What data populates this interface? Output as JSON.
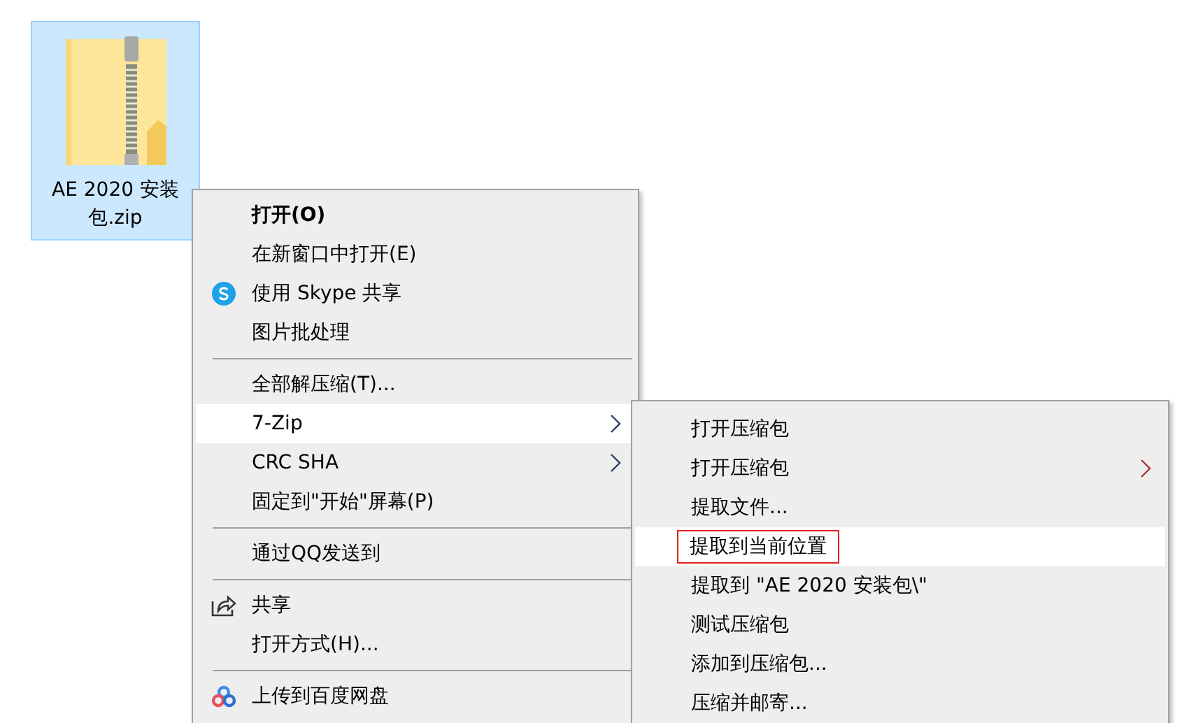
{
  "file": {
    "name": "AE 2020 安装包.zip",
    "selected": true
  },
  "context_menu": {
    "items": [
      {
        "kind": "item",
        "label": "打开(O)",
        "bold": true,
        "has_submenu": false,
        "selected": false
      },
      {
        "kind": "item",
        "label": "在新窗口中打开(E)",
        "bold": false,
        "has_submenu": false,
        "selected": false
      },
      {
        "kind": "skype",
        "label": "使用 Skype 共享",
        "bold": false,
        "has_submenu": false,
        "selected": false
      },
      {
        "kind": "item",
        "label": "图片批处理",
        "bold": false,
        "has_submenu": false,
        "selected": false
      },
      {
        "kind": "separator"
      },
      {
        "kind": "item",
        "label": "全部解压缩(T)...",
        "bold": false,
        "has_submenu": false,
        "selected": false
      },
      {
        "kind": "item",
        "label": "7-Zip",
        "bold": false,
        "has_submenu": true,
        "selected": true
      },
      {
        "kind": "item",
        "label": "CRC SHA",
        "bold": false,
        "has_submenu": true,
        "selected": false
      },
      {
        "kind": "item",
        "label": "固定到\"开始\"屏幕(P)",
        "bold": false,
        "has_submenu": false,
        "selected": false
      },
      {
        "kind": "separator"
      },
      {
        "kind": "item",
        "label": "通过QQ发送到",
        "bold": false,
        "has_submenu": false,
        "selected": false
      },
      {
        "kind": "separator"
      },
      {
        "kind": "share",
        "label": "共享",
        "bold": false,
        "has_submenu": false,
        "selected": false
      },
      {
        "kind": "item",
        "label": "打开方式(H)...",
        "bold": false,
        "has_submenu": false,
        "selected": false
      },
      {
        "kind": "separator"
      },
      {
        "kind": "cloud",
        "label": "上传到百度网盘",
        "bold": false,
        "has_submenu": false,
        "selected": false
      }
    ]
  },
  "submenu": {
    "items": [
      {
        "label": "打开压缩包",
        "has_submenu": false,
        "selected": false,
        "outlined": false
      },
      {
        "label": "打开压缩包",
        "has_submenu": true,
        "selected": false,
        "outlined": false
      },
      {
        "label": "提取文件...",
        "has_submenu": false,
        "selected": false,
        "outlined": false
      },
      {
        "label": "提取到当前位置",
        "has_submenu": false,
        "selected": true,
        "outlined": true
      },
      {
        "label": "提取到 \"AE 2020 安装包\\\"",
        "has_submenu": false,
        "selected": false,
        "outlined": false
      },
      {
        "label": "测试压缩包",
        "has_submenu": false,
        "selected": false,
        "outlined": false
      },
      {
        "label": "添加到压缩包...",
        "has_submenu": false,
        "selected": false,
        "outlined": false
      },
      {
        "label": "压缩并邮寄...",
        "has_submenu": false,
        "selected": false,
        "outlined": false
      }
    ]
  }
}
